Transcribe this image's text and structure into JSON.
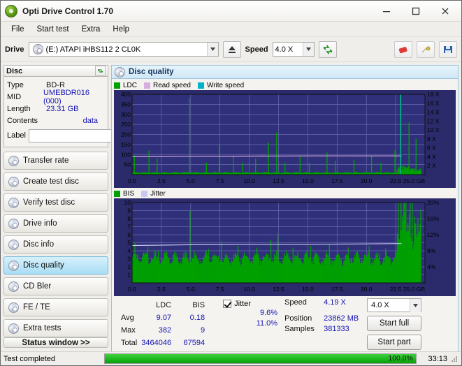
{
  "window": {
    "title": "Opti Drive Control 1.70"
  },
  "menu": {
    "items": [
      "File",
      "Start test",
      "Extra",
      "Help"
    ]
  },
  "drive": {
    "label": "Drive",
    "selected": "(E:)  ATAPI iHBS112   2 CL0K",
    "speed_label": "Speed",
    "speed_value": "4.0 X"
  },
  "disc": {
    "panel_title": "Disc",
    "rows": [
      {
        "key": "Type",
        "value": "BD-R",
        "blue": false
      },
      {
        "key": "MID",
        "value": "UMEBDR016 (000)",
        "blue": true
      },
      {
        "key": "Length",
        "value": "23.31 GB",
        "blue": true
      },
      {
        "key": "Contents",
        "value": "data",
        "blue": true
      }
    ],
    "label_field_label": "Label",
    "label_field_value": ""
  },
  "sidebar": {
    "items": [
      {
        "label": "Transfer rate",
        "selected": false
      },
      {
        "label": "Create test disc",
        "selected": false
      },
      {
        "label": "Verify test disc",
        "selected": false
      },
      {
        "label": "Drive info",
        "selected": false
      },
      {
        "label": "Disc info",
        "selected": false
      },
      {
        "label": "Disc quality",
        "selected": true
      },
      {
        "label": "CD Bler",
        "selected": false
      },
      {
        "label": "FE / TE",
        "selected": false
      },
      {
        "label": "Extra tests",
        "selected": false
      }
    ],
    "status_window": "Status window >>"
  },
  "quality": {
    "title": "Disc quality",
    "legend_top": [
      {
        "name": "LDC",
        "color": "#00a000"
      },
      {
        "name": "Read speed",
        "color": "#d8aee0"
      },
      {
        "name": "Write speed",
        "color": "#00b4c8"
      }
    ],
    "legend_bottom": [
      {
        "name": "BIS",
        "color": "#00a000"
      },
      {
        "name": "Jitter",
        "color": "#c8c8f0"
      }
    ]
  },
  "stats": {
    "col_headers": [
      "LDC",
      "BIS"
    ],
    "rows": [
      {
        "name": "Avg",
        "ldc": "9.07",
        "bis": "0.18"
      },
      {
        "name": "Max",
        "ldc": "382",
        "bis": "9"
      },
      {
        "name": "Total",
        "ldc": "3464046",
        "bis": "67594"
      }
    ],
    "jitter_label": "Jitter",
    "jitter_checked": true,
    "jitter_avg": "9.6%",
    "jitter_max": "11.0%",
    "speed_label": "Speed",
    "speed_value": "4.19 X",
    "speed_select": "4.0 X",
    "position_label": "Position",
    "position_value": "23862 MB",
    "samples_label": "Samples",
    "samples_value": "381333",
    "start_full": "Start full",
    "start_part": "Start part"
  },
  "statusbar": {
    "message": "Test completed",
    "progress_text": "100.0%",
    "progress_percent": 100,
    "time": "33:13"
  },
  "chart_data": [
    {
      "type": "area",
      "title": "LDC / speed",
      "xlabel": "GB",
      "ylabel": "LDC",
      "x_ticks": [
        "0.0",
        "2.5",
        "5.0",
        "7.5",
        "10.0",
        "12.5",
        "15.0",
        "17.5",
        "20.0",
        "22.5",
        "25.0 GB"
      ],
      "xlim": [
        0,
        25
      ],
      "y_ticks": [
        "400",
        "350",
        "300",
        "250",
        "200",
        "150",
        "100",
        "50"
      ],
      "ylim": [
        0,
        400
      ],
      "y2_ticks": [
        "18 X",
        "16 X",
        "14 X",
        "12 X",
        "10 X",
        "8 X",
        "6 X",
        "4 X",
        "2 X"
      ],
      "y2lim": [
        0,
        18
      ],
      "grid": true,
      "series": [
        {
          "name": "LDC",
          "color": "#00a000",
          "baseline_avg": 9,
          "peaks": [
            {
              "x": 0.15,
              "y": 95
            },
            {
              "x": 1.4,
              "y": 120
            },
            {
              "x": 2.1,
              "y": 80
            },
            {
              "x": 4.85,
              "y": 382
            },
            {
              "x": 6.3,
              "y": 60
            },
            {
              "x": 7.4,
              "y": 150
            },
            {
              "x": 8.6,
              "y": 95
            },
            {
              "x": 9.4,
              "y": 60
            },
            {
              "x": 10.5,
              "y": 80
            },
            {
              "x": 11.6,
              "y": 160
            },
            {
              "x": 12.3,
              "y": 210
            },
            {
              "x": 13.0,
              "y": 60
            },
            {
              "x": 14.3,
              "y": 90
            },
            {
              "x": 15.1,
              "y": 60
            },
            {
              "x": 16.6,
              "y": 110
            },
            {
              "x": 17.3,
              "y": 70
            },
            {
              "x": 18.9,
              "y": 75
            },
            {
              "x": 20.4,
              "y": 95
            },
            {
              "x": 21.2,
              "y": 60
            },
            {
              "x": 22.4,
              "y": 120
            },
            {
              "x": 22.9,
              "y": 400
            },
            {
              "x": 23.6,
              "y": 260
            },
            {
              "x": 24.2,
              "y": 180
            }
          ]
        },
        {
          "name": "Read speed",
          "color": "#d8aee0",
          "values_x_speed": [
            [
              0,
              4.0
            ],
            [
              5,
              4.1
            ],
            [
              10,
              4.15
            ],
            [
              15,
              4.2
            ],
            [
              20,
              4.2
            ],
            [
              23,
              4.2
            ]
          ]
        },
        {
          "name": "Write speed",
          "color": "#00b4c8",
          "marker_x": 22.9
        }
      ]
    },
    {
      "type": "area",
      "title": "BIS / jitter",
      "xlabel": "GB",
      "ylabel": "BIS",
      "x_ticks": [
        "0.0",
        "2.5",
        "5.0",
        "7.5",
        "10.0",
        "12.5",
        "15.0",
        "17.5",
        "20.0",
        "22.5",
        "25.0 GB"
      ],
      "xlim": [
        0,
        25
      ],
      "y_ticks": [
        "10",
        "9",
        "8",
        "7",
        "6",
        "5",
        "4",
        "3",
        "2",
        "1"
      ],
      "ylim": [
        0,
        10
      ],
      "y2_ticks": [
        "20%",
        "16%",
        "12%",
        "8%",
        "4%"
      ],
      "y2lim": [
        0,
        20
      ],
      "grid": true,
      "series": [
        {
          "name": "BIS",
          "color": "#00a000",
          "baseline_avg": 2.6,
          "peaks": [
            {
              "x": 0.2,
              "y": 5.0
            },
            {
              "x": 1.3,
              "y": 4.5
            },
            {
              "x": 2.2,
              "y": 4.0
            },
            {
              "x": 4.9,
              "y": 9.0
            },
            {
              "x": 6.5,
              "y": 4.2
            },
            {
              "x": 7.6,
              "y": 5.2
            },
            {
              "x": 9.0,
              "y": 4.6
            },
            {
              "x": 10.6,
              "y": 4.4
            },
            {
              "x": 11.8,
              "y": 5.4
            },
            {
              "x": 12.4,
              "y": 6.1
            },
            {
              "x": 13.7,
              "y": 4.4
            },
            {
              "x": 15.2,
              "y": 4.6
            },
            {
              "x": 16.8,
              "y": 4.8
            },
            {
              "x": 18.4,
              "y": 4.4
            },
            {
              "x": 20.2,
              "y": 4.6
            },
            {
              "x": 21.6,
              "y": 4.3
            },
            {
              "x": 22.6,
              "y": 6.0
            },
            {
              "x": 22.9,
              "y": 10.0
            },
            {
              "x": 23.5,
              "y": 7.5
            },
            {
              "x": 24.3,
              "y": 6.0
            }
          ]
        },
        {
          "name": "Jitter",
          "color": "#c8c8f0",
          "values_x_pct": [
            [
              0,
              9.3
            ],
            [
              5,
              9.5
            ],
            [
              10,
              9.6
            ],
            [
              15,
              9.6
            ],
            [
              20,
              9.7
            ],
            [
              23,
              9.8
            ]
          ]
        }
      ]
    }
  ]
}
